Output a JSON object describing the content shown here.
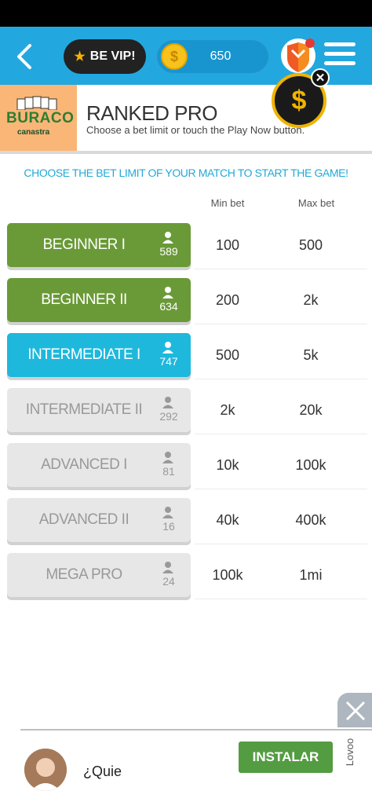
{
  "topbar": {
    "vip_label": "BE VIP!",
    "coins": "650"
  },
  "header": {
    "logo_brand": "BURACO",
    "logo_sub": "canastra",
    "title": "RANKED PRO",
    "subtitle": "Choose a bet limit or touch the Play Now button."
  },
  "instruction": "CHOOSE THE BET LIMIT OF YOUR MATCH TO START THE GAME!",
  "columns": {
    "min": "Min bet",
    "max": "Max bet"
  },
  "levels": [
    {
      "name": "BEGINNER I",
      "players": "589",
      "min": "100",
      "max": "500",
      "state": "green"
    },
    {
      "name": "BEGINNER II",
      "players": "634",
      "min": "200",
      "max": "2k",
      "state": "green"
    },
    {
      "name": "INTERMEDIATE I",
      "players": "747",
      "min": "500",
      "max": "5k",
      "state": "cyan"
    },
    {
      "name": "INTERMEDIATE II",
      "players": "292",
      "min": "2k",
      "max": "20k",
      "state": "grey"
    },
    {
      "name": "ADVANCED I",
      "players": "81",
      "min": "10k",
      "max": "100k",
      "state": "grey"
    },
    {
      "name": "ADVANCED II",
      "players": "16",
      "min": "40k",
      "max": "400k",
      "state": "grey"
    },
    {
      "name": "MEGA PRO",
      "players": "24",
      "min": "100k",
      "max": "1mi",
      "state": "grey"
    }
  ],
  "ad": {
    "text": "¿Quie",
    "install_label": "INSTALAR",
    "brand": "Lovoo"
  },
  "colors": {
    "topbar": "#22a8df",
    "green": "#6a9a37",
    "cyan": "#1fb8dd",
    "grey": "#e7e7e7",
    "accent_text": "#21a9d5"
  }
}
